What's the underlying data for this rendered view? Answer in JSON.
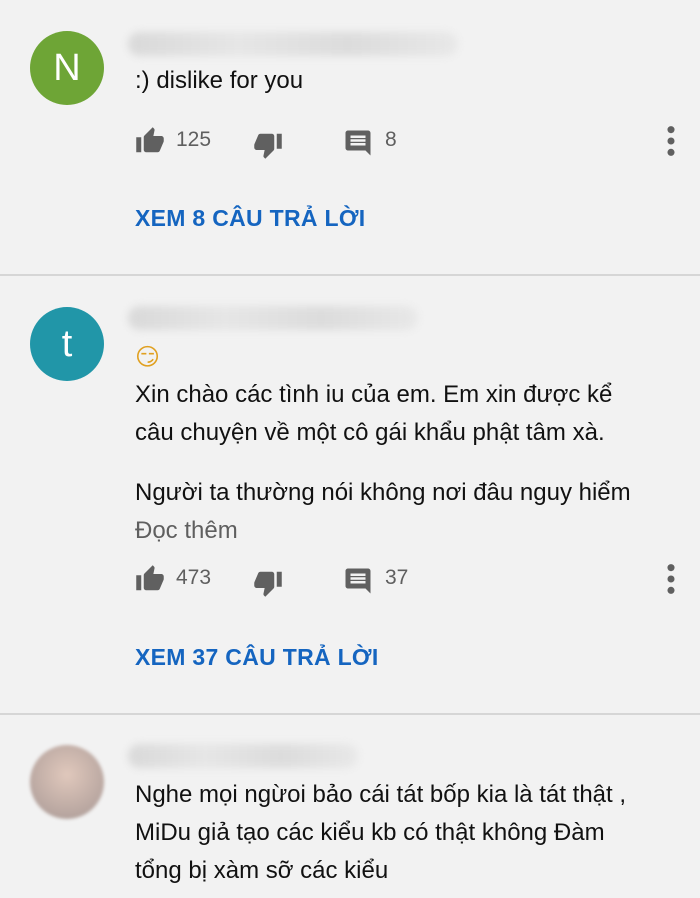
{
  "comments": [
    {
      "avatar_letter": "N",
      "avatar_color": "#6ea536",
      "text_lines": [
        ":) dislike for you"
      ],
      "likes": "125",
      "reply_count": "8",
      "view_replies": "XEM 8 CÂU TRẢ LỜI"
    },
    {
      "avatar_letter": "t",
      "avatar_color": "#2196a8",
      "emoji": "😏",
      "text_lines": [
        "Xin chào các tình iu của em. Em xin được kể",
        "câu chuyện về một cô gái khẩu phật tâm xà.",
        "",
        "Người ta thường nói không nơi đâu nguy hiểm"
      ],
      "read_more": "Đọc thêm",
      "likes": "473",
      "reply_count": "37",
      "view_replies": "XEM 37 CÂU TRẢ LỜI"
    },
    {
      "avatar_letter": "",
      "avatar_color": "#c9b5a8",
      "text_lines": [
        "Nghe mọi ngừoi bảo cái tát bốp kia là tát thật ,",
        "MiDu giả tạo các kiểu kb có thật không Đàm",
        "tổng bị xàm sỡ các kiểu"
      ]
    }
  ],
  "icons": {
    "like": "thumb-up-icon",
    "dislike": "thumb-down-icon",
    "reply": "comment-icon",
    "more": "more-vert-icon"
  },
  "colors": {
    "link": "#1565c0",
    "background": "#f2f2f2",
    "secondary_text": "#5f5f5f"
  }
}
